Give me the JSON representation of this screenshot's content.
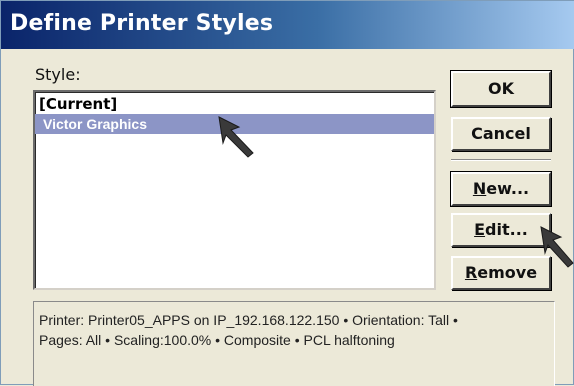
{
  "dialog": {
    "title": "Define Printer Styles"
  },
  "style_section": {
    "label": "Style:",
    "items": [
      {
        "label": "[Current]",
        "selected": false
      },
      {
        "label": "Victor Graphics",
        "selected": true
      }
    ]
  },
  "buttons": {
    "ok": {
      "label": "OK",
      "mnemonic": ""
    },
    "cancel": {
      "label": "Cancel",
      "mnemonic": ""
    },
    "new": {
      "label": "New...",
      "mnemonic": "N"
    },
    "edit": {
      "label": "Edit...",
      "mnemonic": "E"
    },
    "remove": {
      "label": "Remove",
      "mnemonic": "R"
    }
  },
  "info": {
    "line1": "Printer: Printer05_APPS on IP_192.168.122.150 • Orientation: Tall •",
    "line2": "Pages: All • Scaling:100.0% • Composite • PCL halftoning"
  },
  "colors": {
    "title_bar": "#0a246a",
    "selection": "#8c95c6",
    "face": "#ece9d8"
  },
  "icons": [
    "pointer-arrow-icon"
  ]
}
